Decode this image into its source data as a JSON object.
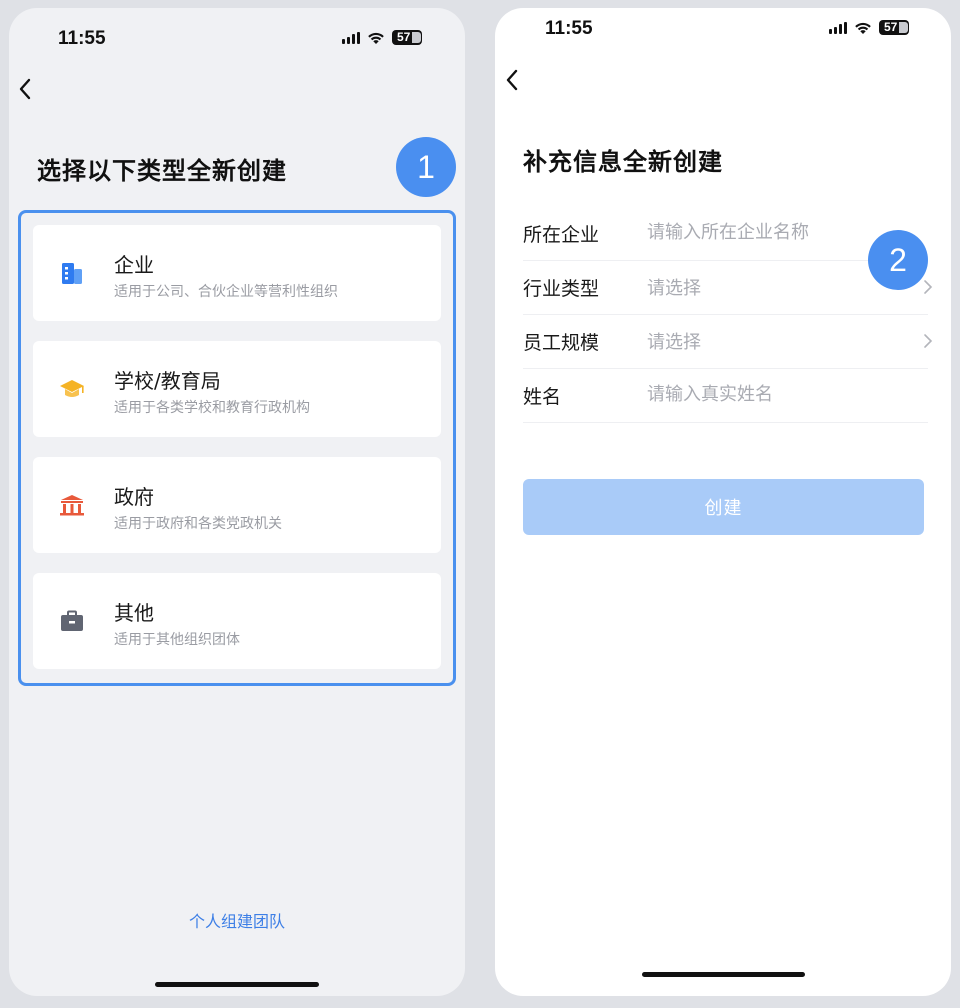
{
  "colors": {
    "accent": "#4a8ff0",
    "link": "#3d7fe6",
    "button_disabled": "#a9cbf8",
    "icon_enterprise": "#2f7bf0",
    "icon_school": "#f5b325",
    "icon_government": "#e8593b",
    "icon_other": "#606572"
  },
  "left_screen": {
    "status": {
      "time": "11:55",
      "battery": "57"
    },
    "step_number": "1",
    "title": "选择以下类型全新创建",
    "types": [
      {
        "icon": "building-icon",
        "name": "企业",
        "desc": "适用于公司、合伙企业等营利性组织"
      },
      {
        "icon": "graduation-cap-icon",
        "name": "学校/教育局",
        "desc": "适用于各类学校和教育行政机构"
      },
      {
        "icon": "government-building-icon",
        "name": "政府",
        "desc": "适用于政府和各类党政机关"
      },
      {
        "icon": "briefcase-icon",
        "name": "其他",
        "desc": "适用于其他组织团体"
      }
    ],
    "personal_team_link": "个人组建团队"
  },
  "right_screen": {
    "status": {
      "time": "11:55",
      "battery": "57"
    },
    "step_number": "2",
    "title": "补充信息全新创建",
    "fields": {
      "company": {
        "label": "所在企业",
        "placeholder": "请输入所在企业名称"
      },
      "industry": {
        "label": "行业类型",
        "value": "请选择"
      },
      "staff_size": {
        "label": "员工规模",
        "value": "请选择"
      },
      "name": {
        "label": "姓名",
        "placeholder": "请输入真实姓名"
      }
    },
    "create_button": "创建"
  }
}
